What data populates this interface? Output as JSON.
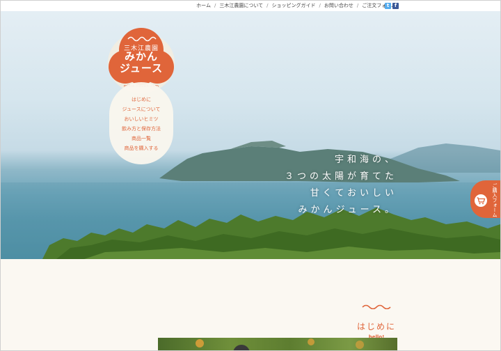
{
  "nav": {
    "items": [
      "ホーム",
      "三木江農園について",
      "ショッピングガイド",
      "お問い合わせ",
      "ご注文フォーム"
    ],
    "separator": "/"
  },
  "social": {
    "twitter": "t",
    "facebook": "f"
  },
  "logo": {
    "small": "三木江農園",
    "big_line1": "みかん",
    "big_line2": "ジュース",
    "url": "mikie-nouen.com"
  },
  "menu": {
    "items": [
      "はじめに",
      "ジュースについて",
      "おいしいヒミツ",
      "飲み方と保存方法",
      "商品一覧",
      "商品を購入する"
    ]
  },
  "hero": {
    "lines": [
      "宇和海の、",
      "３つの太陽が育てた",
      "甘くておいしい",
      "みかんジュース。"
    ]
  },
  "order_tab": {
    "label": "ご購入フォーム",
    "icon": "cart-icon"
  },
  "hello": {
    "title": "はじめに",
    "sub": "hello!"
  },
  "colors": {
    "accent": "#e0653a",
    "background": "#fbf8f2"
  }
}
